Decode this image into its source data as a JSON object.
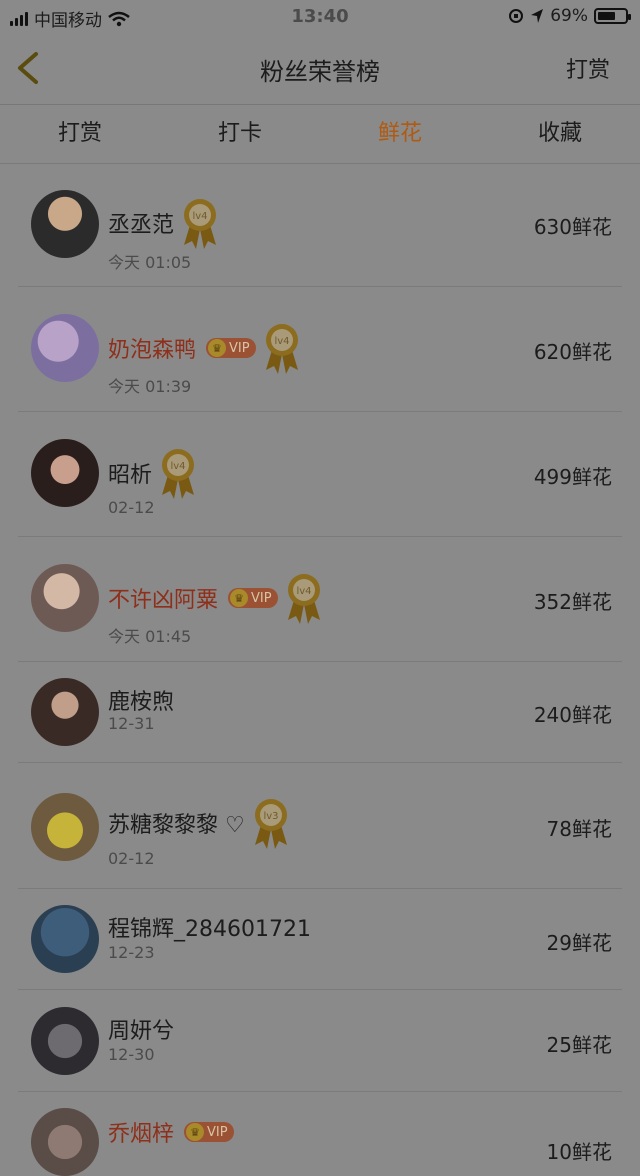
{
  "status": {
    "carrier": "中国移动",
    "time": "13:40",
    "battery_text": "69%",
    "battery_level": 0.69
  },
  "header": {
    "title": "粉丝荣誉榜",
    "action": "打赏"
  },
  "tabs": [
    {
      "label": "打赏",
      "active": false
    },
    {
      "label": "打卡",
      "active": false
    },
    {
      "label": "鲜花",
      "active": true
    },
    {
      "label": "收藏",
      "active": false
    }
  ],
  "items": [
    {
      "name": "丞丞范",
      "vip": false,
      "level": "lv4",
      "time": "今天 01:05",
      "count": "630鲜花"
    },
    {
      "name": "奶泡森鸭",
      "vip": true,
      "vip_label": "VIP",
      "level": "lv4",
      "time": "今天 01:39",
      "count": "620鲜花"
    },
    {
      "name": "昭析",
      "vip": false,
      "level": "lv4",
      "time": "02-12",
      "count": "499鲜花"
    },
    {
      "name": "不许凶阿粟",
      "vip": true,
      "vip_label": "VIP",
      "level": "lv4",
      "time": "今天 01:45",
      "count": "352鲜花"
    },
    {
      "name": "鹿桉煦",
      "vip": false,
      "level": "",
      "time": "12-31",
      "count": "240鲜花"
    },
    {
      "name": "苏糖黎黎黎 ♡",
      "vip": false,
      "level": "lv3",
      "time": "02-12",
      "count": "78鲜花"
    },
    {
      "name": "程锦辉_284601721",
      "vip": false,
      "level": "",
      "time": "12-23",
      "count": "29鲜花"
    },
    {
      "name": "周妍兮",
      "vip": false,
      "level": "",
      "time": "12-30",
      "count": "25鲜花"
    },
    {
      "name": "乔烟梓",
      "vip": true,
      "vip_label": "VIP",
      "level": "",
      "time": "",
      "count": "10鲜花"
    }
  ],
  "colors": {
    "overlay_bg": "#8a8a8a",
    "active_tab": "#b05a12",
    "vip_name": "#8e2f1a"
  }
}
